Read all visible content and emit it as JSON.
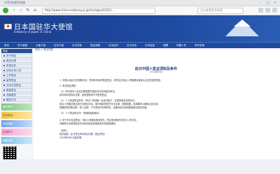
{
  "browser": {
    "window_title": "2345加速浏览器",
    "url": "http://www.china-embassy.or.jp/chn/sgxx/t1224...",
    "search_placeholder": "点击查看更多新闻"
  },
  "site": {
    "title": "日本国驻华大使馆",
    "subtitle": "Embassy of Japan in China",
    "menu": [
      "首页",
      "关于使馆",
      "大使介绍",
      "日本介绍",
      "日中关系",
      "签证领事",
      "日本经济",
      "日中交流",
      "日本信息",
      "招聘",
      "外籍人员",
      "来华咨询"
    ]
  },
  "breadcrumb": "首页 > 签证须知",
  "sidebar": {
    "header": "签证",
    "items": [
      "关于签证",
      "签证分类",
      "申请文件",
      "访问日本人员",
      "工作签证",
      "留学签证",
      "文化交流签证",
      "居留签证",
      "领事服务",
      "联系方式"
    ],
    "promos": [
      "樱花季节",
      "日本旅游",
      "签证指南",
      "日语学习",
      "使馆动态"
    ]
  },
  "article": {
    "title": "赴日中国人签证须知及条件",
    "date": "2018年9月",
    "paragraphs": [
      "1. 中国公民赴日本短期访问，须持有有效护照及签证，并符合日本出入境管理及难民认定法的相关规定。",
      "2. 申请签证须知：",
      "（1）申请须本人亲自办理或委托指定代办机构递交申请。",
      "    申请材料须真实完整，如有虚假将不予签发签证。",
      "（2）个人旅游签证条件：申请人须具备一定经济能力，并提供相关证明文件。",
      "    申请人须通过指定旅行社提出申请，旅行期间须遵守日本法律，按期回国。具体要求以使馆公告为准。",
      "    需要提供在职证明、收入证明、户口簿复印件等材料，详细内容请参阅使馆网站相关页面。",
      "（3）个人签证申请书：须使用最新版本。",
      "3. 关于多次往返签证：申请人须满足相关条件，签证有效期内可多次入境日本。",
      "    详细条件请咨询指定代办机构或查阅使馆发布的最新通知。",
      "（参考）",
      "相关链接：赴日签证申请常见问题（签证须知）",
      "2018年9月1日起实施"
    ]
  },
  "colors": {
    "banner": "#1e4aa0",
    "link": "#1f3f7a"
  }
}
